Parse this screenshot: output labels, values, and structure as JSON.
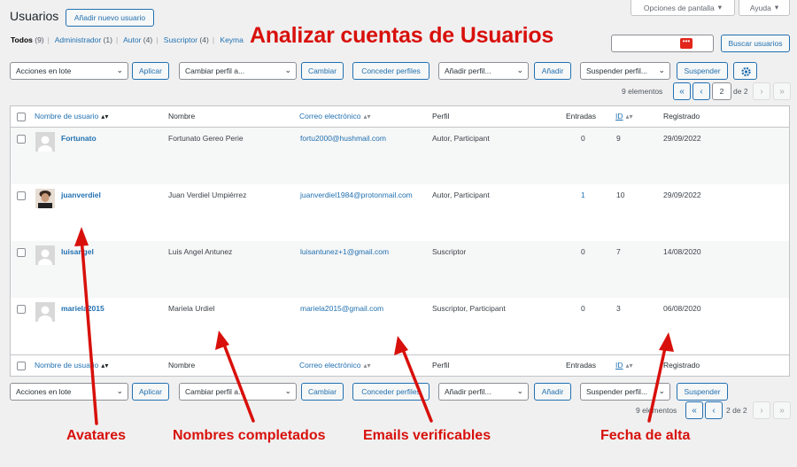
{
  "page": {
    "title": "Usuarios",
    "add_new_label": "Añadir nuevo usuario",
    "screen_options_label": "Opciones de pantalla",
    "help_label": "Ayuda"
  },
  "filters": [
    {
      "label": "Todos",
      "count": "(9)"
    },
    {
      "label": "Administrador",
      "count": "(1)"
    },
    {
      "label": "Autor",
      "count": "(4)"
    },
    {
      "label": "Suscriptor",
      "count": "(4)"
    },
    {
      "label": "Keyma",
      "count": ""
    }
  ],
  "search": {
    "button_label": "Buscar usuarios",
    "password_icon": "•••"
  },
  "toolbar_top": {
    "bulk_select": "Acciones en lote",
    "apply_label": "Aplicar",
    "change_role_select": "Cambiar perfil a...",
    "change_label": "Cambiar",
    "grant_roles_label": "Conceder perfiles",
    "add_role_select": "Añadir perfil...",
    "add_label": "Añadir",
    "suspend_select": "Suspender perfil...",
    "suspend_label": "Suspender",
    "items_count": "9 elementos",
    "first_page": "«",
    "prev_page": "‹",
    "current_page": "2",
    "of_total": "de 2",
    "next_page": "›",
    "last_page": "»"
  },
  "toolbar_bottom": {
    "bulk_select": "Acciones en lote",
    "apply_label": "Aplicar",
    "change_role_select": "Cambiar perfil a...",
    "change_label": "Cambiar",
    "grant_roles_label": "Conceder perfiles",
    "add_role_select": "Añadir perfil...",
    "add_label": "Añadir",
    "suspend_select": "Suspender perfil...",
    "suspend_label": "Suspender",
    "items_count": "9 elementos",
    "first_page": "«",
    "prev_page": "‹",
    "page_text": "2 de 2",
    "next_page": "›",
    "last_page": "»"
  },
  "columns": {
    "username": "Nombre de usuario",
    "name": "Nombre",
    "email": "Correo electrónico",
    "role": "Perfil",
    "posts": "Entradas",
    "id": "ID",
    "registered": "Registrado"
  },
  "rows": [
    {
      "username": "Fortunato",
      "name": "Fortunato Gereo Perie",
      "email": "fortu2000@hushmail.com",
      "role": "Autor, Participant",
      "posts": "0",
      "id": "9",
      "registered": "29/09/2022"
    },
    {
      "username": "juanverdiel",
      "name": "Juan Verdiel Umpiérrez",
      "email": "juanverdiel1984@protonmail.com",
      "role": "Autor, Participant",
      "posts": "1",
      "id": "10",
      "registered": "29/09/2022"
    },
    {
      "username": "luisangel",
      "name": "Luis Angel Antunez",
      "email": "luisantunez+1@gmail.com",
      "role": "Suscriptor",
      "posts": "0",
      "id": "7",
      "registered": "14/08/2020"
    },
    {
      "username": "mariela2015",
      "name": "Mariela Urdiel",
      "email": "mariela2015@gmail.com",
      "role": "Suscriptor, Participant",
      "posts": "0",
      "id": "3",
      "registered": "06/08/2020"
    }
  ],
  "annotations": {
    "headline": "Analizar cuentas de Usuarios",
    "avatars": "Avatares",
    "full_names": "Nombres completados",
    "emails": "Emails verificables",
    "signup_date": "Fecha de alta"
  },
  "colors": {
    "accent": "#2271b1",
    "annotation_red": "#d8100b",
    "password_badge": "#e2261c"
  }
}
